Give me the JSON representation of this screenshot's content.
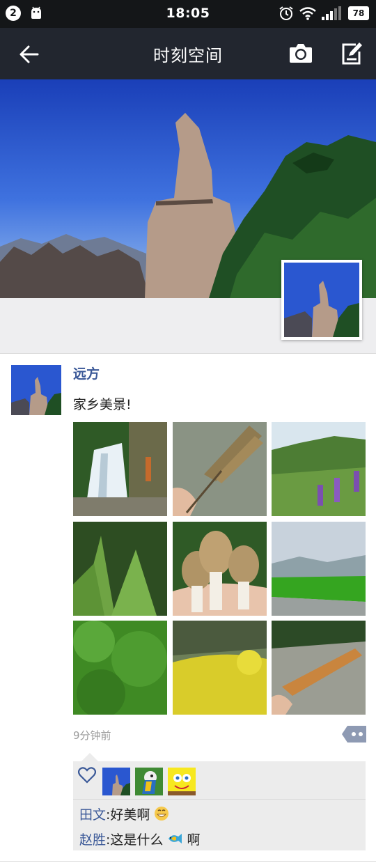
{
  "status_bar": {
    "notification_count": "2",
    "time": "18:05",
    "battery": "78",
    "icons": [
      "android-icon",
      "alarm-icon",
      "wifi-icon",
      "signal-icon",
      "battery-icon"
    ]
  },
  "header": {
    "title": "时刻空间",
    "icons": [
      "back-arrow-icon",
      "camera-icon",
      "compose-icon"
    ]
  },
  "post": {
    "author": "远方",
    "text": "家乡美景!",
    "time": "9分钟前",
    "photos": [
      "waterfall",
      "grilled-fish",
      "purple-wildflowers",
      "ferns",
      "morel-mushrooms",
      "green-field-road",
      "green-shrubs",
      "yellow-rapeseed-flowers",
      "roasted-fish-on-rocks"
    ]
  },
  "likes": {
    "icon": "heart-icon",
    "avatars": [
      "mountain-peak-avatar",
      "parrot-avatar",
      "spongebob-avatar"
    ]
  },
  "comments": [
    {
      "name": "田文",
      "sep": ":",
      "text": "好美啊",
      "emoji": "grin-emoji"
    },
    {
      "name": "赵胜",
      "sep": ":",
      "text": "这是什么",
      "emoji": "fish-emoji",
      "text_after": "啊"
    }
  ],
  "colors": {
    "status_bar": "#141618",
    "title_bar": "#22262f",
    "link_name": "#3b5998",
    "panel": "#ececec"
  }
}
